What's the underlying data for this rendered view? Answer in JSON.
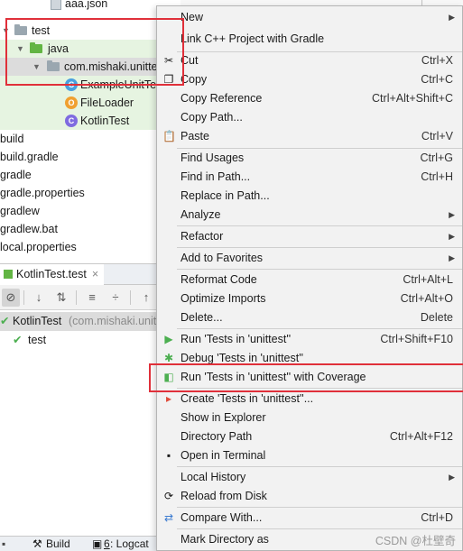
{
  "project_tree": {
    "aaa_json": "aaa.json",
    "test_folder": "test",
    "java_folder": "java",
    "package_name": "com.mishaki.unitte",
    "example_test": "ExampleUnitTe",
    "file_loader": "FileLoader",
    "kotlin_test": "KotlinTest",
    "files": [
      "build",
      "build.gradle",
      "gradle",
      "gradle.properties",
      "gradlew",
      "gradlew.bat",
      "local.properties"
    ]
  },
  "run_panel": {
    "tab_label": "KotlinTest.test",
    "tab_close": "×",
    "result_class": "KotlinTest",
    "result_package": "(com.mishaki.unit",
    "result_method": "test"
  },
  "bottom_bar": {
    "build": "Build",
    "logcat_num": "6",
    "logcat": ": Logcat"
  },
  "menu": {
    "new": "New",
    "link_cpp": "Link C++ Project with Gradle",
    "cut": "Cut",
    "cut_sc": "Ctrl+X",
    "copy": "Copy",
    "copy_sc": "Ctrl+C",
    "copy_ref": "Copy Reference",
    "copy_ref_sc": "Ctrl+Alt+Shift+C",
    "copy_path": "Copy Path...",
    "paste": "Paste",
    "paste_sc": "Ctrl+V",
    "find_usages": "Find Usages",
    "find_usages_sc": "Ctrl+G",
    "find_in_path": "Find in Path...",
    "find_in_path_sc": "Ctrl+H",
    "replace_in_path": "Replace in Path...",
    "analyze": "Analyze",
    "refactor": "Refactor",
    "add_favorites": "Add to Favorites",
    "reformat": "Reformat Code",
    "reformat_sc": "Ctrl+Alt+L",
    "optimize": "Optimize Imports",
    "optimize_sc": "Ctrl+Alt+O",
    "delete": "Delete...",
    "delete_sc": "Delete",
    "run_tests": "Run 'Tests in 'unittest''",
    "run_tests_sc": "Ctrl+Shift+F10",
    "debug_tests": "Debug 'Tests in 'unittest''",
    "run_coverage": "Run 'Tests in 'unittest'' with Coverage",
    "create_tests": "Create 'Tests in 'unittest''...",
    "show_explorer": "Show in Explorer",
    "directory_path": "Directory Path",
    "directory_path_sc": "Ctrl+Alt+F12",
    "open_terminal": "Open in Terminal",
    "local_history": "Local History",
    "reload_disk": "Reload from Disk",
    "compare_with": "Compare With...",
    "compare_with_sc": "Ctrl+D",
    "mark_directory": "Mark Directory as"
  },
  "watermark": "CSDN @杜壁奇",
  "colors": {
    "highlight_box": "#e0303a",
    "run_green": "#4caf50",
    "selection": "#dcdcdc"
  }
}
